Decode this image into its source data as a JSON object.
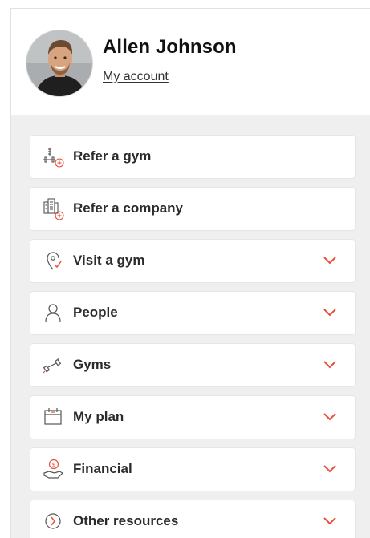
{
  "profile": {
    "name": "Allen Johnson",
    "account_link": "My account",
    "avatar_icon": "user-avatar-photo"
  },
  "menu": {
    "items": [
      {
        "label": "Refer a gym",
        "icon": "refer-gym-icon",
        "expandable": false
      },
      {
        "label": "Refer a company",
        "icon": "refer-company-icon",
        "expandable": false
      },
      {
        "label": "Visit a gym",
        "icon": "location-pin-icon",
        "expandable": true
      },
      {
        "label": "People",
        "icon": "person-icon",
        "expandable": true
      },
      {
        "label": "Gyms",
        "icon": "dumbbell-icon",
        "expandable": true
      },
      {
        "label": "My plan",
        "icon": "calendar-icon",
        "expandable": true
      },
      {
        "label": "Financial",
        "icon": "money-hand-icon",
        "expandable": true
      },
      {
        "label": "Other resources",
        "icon": "resources-icon",
        "expandable": true
      }
    ]
  },
  "colors": {
    "accent": "#e8503a",
    "text": "#2b2b2b",
    "background": "#efefef",
    "card": "#ffffff"
  }
}
